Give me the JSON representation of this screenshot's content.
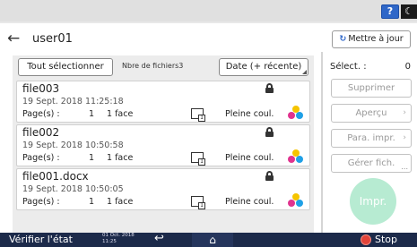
{
  "top": {
    "help_label": "?",
    "night_label": "☾"
  },
  "header": {
    "title": "user01",
    "back_icon": "←",
    "refresh_label": "Mettre à jour",
    "refresh_icon": "↻"
  },
  "toolbar": {
    "select_all_label": "Tout sélectionner",
    "count_label": "Nbre de fichiers3",
    "sort_label": "Date (+ récente)"
  },
  "files": [
    {
      "name": "file003",
      "date": "19 Sept. 2018 11:25:18",
      "pages_label": "Page(s) :",
      "pages": "1",
      "sides": "1 face",
      "color_mode": "Pleine coul.",
      "doc_badge": "1"
    },
    {
      "name": "file002",
      "date": "19 Sept. 2018 10:50:58",
      "pages_label": "Page(s) :",
      "pages": "1",
      "sides": "1 face",
      "color_mode": "Pleine coul.",
      "doc_badge": "1"
    },
    {
      "name": "file001.docx",
      "date": "19 Sept. 2018 10:50:05",
      "pages_label": "Page(s) :",
      "pages": "1",
      "sides": "1 face",
      "color_mode": "Pleine coul.",
      "doc_badge": "1"
    }
  ],
  "side": {
    "select_label": "Sélect. :",
    "select_count": "0",
    "delete_label": "Supprimer",
    "preview_label": "Aperçu",
    "print_params_label": "Para. impr.",
    "manage_label": "Gérer fich.",
    "print_label": "Impr.",
    "chevron": "›",
    "more_dots": "..."
  },
  "footer": {
    "status_label": "Vérifier l'état",
    "date": "01 Oct. 2018",
    "time": "11:25",
    "return_icon": "↩",
    "home_icon": "⌂",
    "stop_label": "Stop"
  },
  "colors": {
    "accent_blue": "#2f67c8",
    "footer_bg": "#1c2a4a",
    "print_button": "#b7ebd2",
    "stop_red": "#e2443a"
  }
}
